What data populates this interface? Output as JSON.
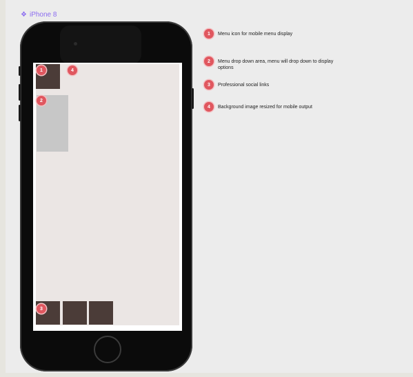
{
  "frame": {
    "label": "iPhone 8",
    "label_color": "#8b6cf0"
  },
  "colors": {
    "badge": "#e0575f",
    "dark_box": "#4b3c38",
    "dropdown": "#c7c7c7",
    "screen_bg": "#ebe6e4",
    "phone_body": "#0b0b0b"
  },
  "phone": {
    "badges": {
      "menu_icon": "1",
      "dropdown": "2",
      "social": "3",
      "background": "4"
    }
  },
  "legend": [
    {
      "number": "1",
      "text": "Menu icon for mobile menu display"
    },
    {
      "number": "2",
      "text": "Menu drop down area, menu will drop down to display options"
    },
    {
      "number": "3",
      "text": "Professional social links"
    },
    {
      "number": "4",
      "text": "Background image resized for mobile output"
    }
  ]
}
